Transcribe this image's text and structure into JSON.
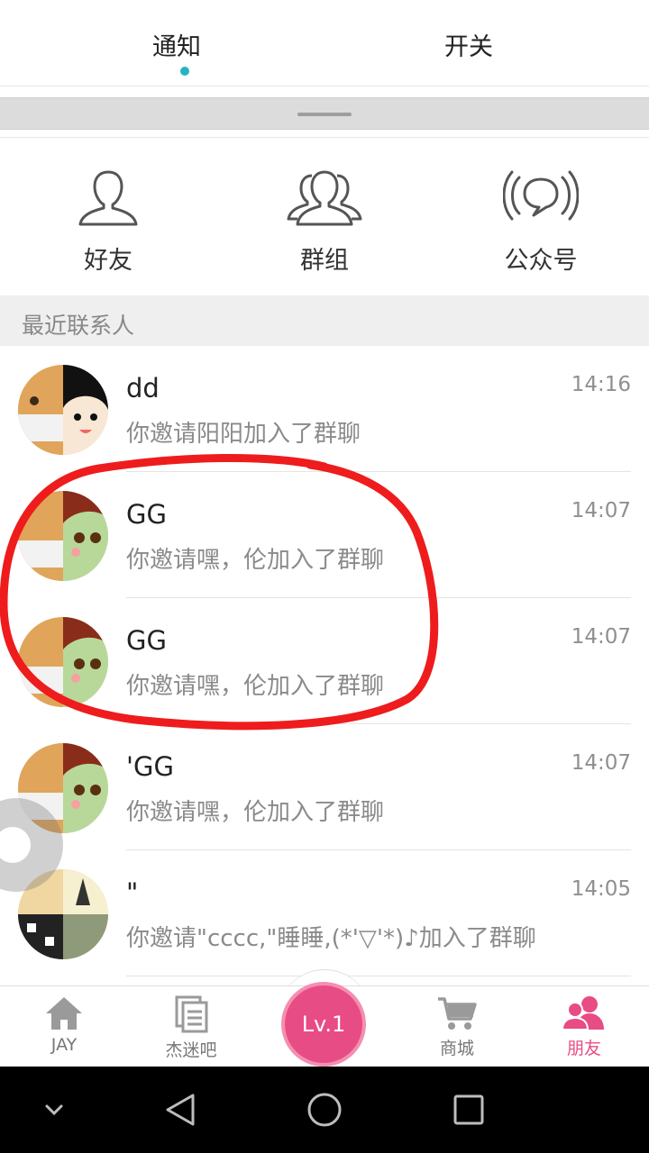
{
  "tabs": [
    {
      "label": "通知",
      "active": true
    },
    {
      "label": "开关",
      "active": false
    }
  ],
  "categories": [
    {
      "label": "好友",
      "icon": "person-icon"
    },
    {
      "label": "群组",
      "icon": "group-icon"
    },
    {
      "label": "公众号",
      "icon": "broadcast-icon"
    }
  ],
  "section_title": "最近联系人",
  "contacts": [
    {
      "name": "dd",
      "time": "14:16",
      "message": "你邀请阳阳加入了群聊"
    },
    {
      "name": "GG",
      "time": "14:07",
      "message": "你邀请嘿，伦加入了群聊"
    },
    {
      "name": "GG",
      "time": "14:07",
      "message": "你邀请嘿，伦加入了群聊"
    },
    {
      "name": "'GG",
      "time": "14:07",
      "message": "你邀请嘿，伦加入了群聊"
    },
    {
      "name": "\"",
      "time": "14:05",
      "message": "你邀请\"cccc,\"睡睡,(*'▽'*)♪加入了群聊"
    }
  ],
  "bottom_nav": {
    "jay": "JAY",
    "fans": "杰迷吧",
    "level": "Lv.1",
    "shop": "商城",
    "friends": "朋友"
  },
  "colors": {
    "accent_teal": "#25b4c2",
    "accent_pink": "#e84c84",
    "annotation_red": "#ee1c1c"
  }
}
